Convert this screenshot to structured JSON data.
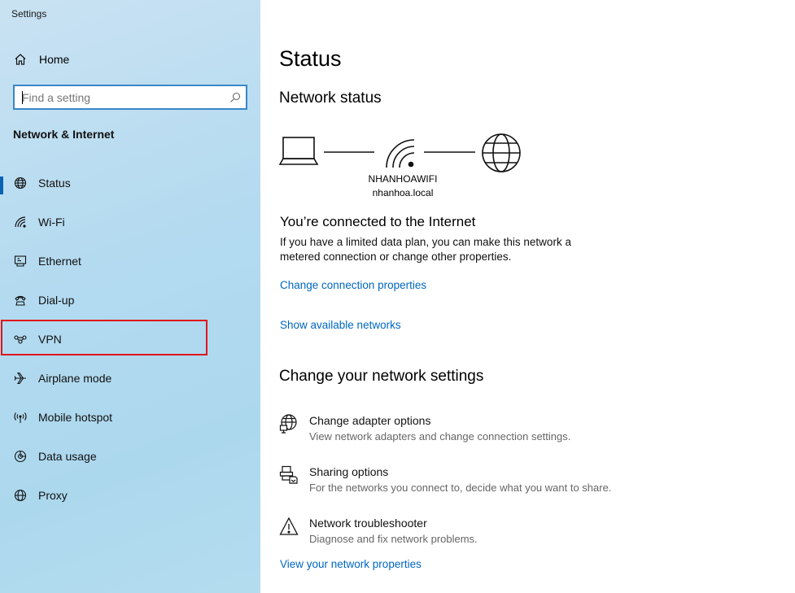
{
  "window": {
    "title": "Settings"
  },
  "sidebar": {
    "home_label": "Home",
    "search": {
      "placeholder": "Find a setting",
      "value": ""
    },
    "section_title": "Network & Internet",
    "items": [
      {
        "label": "Status",
        "icon": "globe-icon",
        "active": true
      },
      {
        "label": "Wi-Fi",
        "icon": "wifi-icon"
      },
      {
        "label": "Ethernet",
        "icon": "ethernet-icon"
      },
      {
        "label": "Dial-up",
        "icon": "phone-icon"
      },
      {
        "label": "VPN",
        "icon": "vpn-icon",
        "highlighted": true
      },
      {
        "label": "Airplane mode",
        "icon": "airplane-icon"
      },
      {
        "label": "Mobile hotspot",
        "icon": "hotspot-icon"
      },
      {
        "label": "Data usage",
        "icon": "data-usage-icon"
      },
      {
        "label": "Proxy",
        "icon": "globe-icon"
      }
    ]
  },
  "main": {
    "title": "Status",
    "network_status_heading": "Network status",
    "network": {
      "ssid": "NHANHOAWIFI",
      "domain": "nhanhoa.local"
    },
    "connected_heading": "You’re connected to the Internet",
    "connected_desc": "If you have a limited data plan, you can make this network a metered connection or change other properties.",
    "link_change_connection": "Change connection properties",
    "link_show_networks": "Show available networks",
    "change_settings_heading": "Change your network settings",
    "options": [
      {
        "title": "Change adapter options",
        "subtitle": "View network adapters and change connection settings.",
        "icon": "adapter-icon"
      },
      {
        "title": "Sharing options",
        "subtitle": "For the networks you connect to, decide what you want to share.",
        "icon": "sharing-icon"
      },
      {
        "title": "Network troubleshooter",
        "subtitle": "Diagnose and fix network problems.",
        "icon": "warning-icon"
      }
    ],
    "link_view_properties": "View your network properties"
  },
  "colors": {
    "accent": "#0a62b3",
    "link": "#0067c0",
    "highlight": "#e0161b",
    "sidebar_bg": "#b3daf0"
  }
}
